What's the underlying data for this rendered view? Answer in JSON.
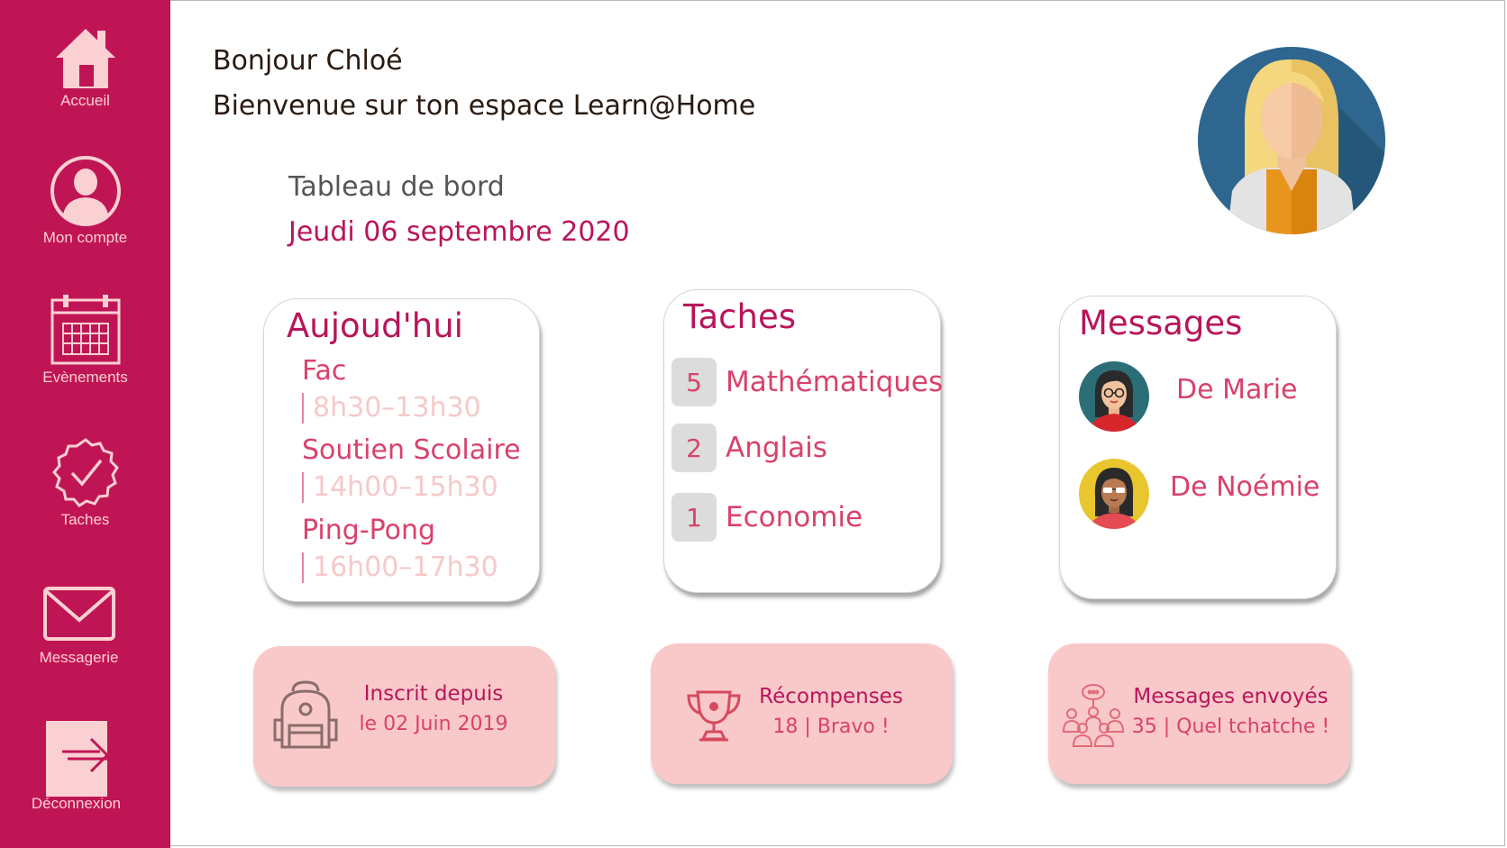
{
  "sidebar": {
    "items": [
      {
        "label": "Accueil",
        "icon": "home-icon"
      },
      {
        "label": "Mon compte",
        "icon": "user-icon"
      },
      {
        "label": "Evènements",
        "icon": "calendar-icon"
      },
      {
        "label": "Taches",
        "icon": "check-badge-icon"
      },
      {
        "label": "Messagerie",
        "icon": "envelope-icon"
      },
      {
        "label": "Déconnexion",
        "icon": "logout-icon"
      }
    ]
  },
  "header": {
    "greeting": "Bonjour Chloé",
    "welcome": "Bienvenue sur ton espace Learn@Home"
  },
  "dashboard": {
    "title": "Tableau de bord",
    "date": "Jeudi 06 septembre 2020"
  },
  "today": {
    "title": "Aujoud'hui",
    "events": [
      {
        "name": "Fac",
        "time": "8h30–13h30"
      },
      {
        "name": "Soutien Scolaire",
        "time": "14h00–15h30"
      },
      {
        "name": "Ping-Pong",
        "time": "16h00–17h30"
      }
    ]
  },
  "tasks": {
    "title": "Taches",
    "items": [
      {
        "count": "5",
        "subject": "Mathématiques"
      },
      {
        "count": "2",
        "subject": "Anglais"
      },
      {
        "count": "1",
        "subject": "Economie"
      }
    ]
  },
  "messages": {
    "title": "Messages",
    "items": [
      {
        "from": "De Marie"
      },
      {
        "from": "De Noémie"
      }
    ]
  },
  "stats": [
    {
      "line1": "Inscrit depuis",
      "line2": "le 02 Juin 2019",
      "icon": "backpack-icon"
    },
    {
      "line1": "Récompenses",
      "line2": "18 | Bravo !",
      "icon": "trophy-icon"
    },
    {
      "line1": "Messages envoyés",
      "line2": "35 | Quel tchatche !",
      "icon": "community-icon"
    }
  ],
  "colors": {
    "sidebar": "#c01554",
    "accent": "#b8155b",
    "accent_light": "#d9416c",
    "tile": "#f9c9c9"
  }
}
